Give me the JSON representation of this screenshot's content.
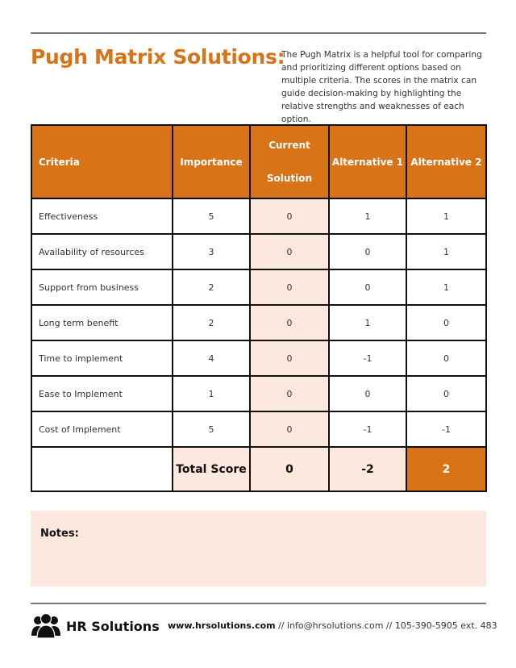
{
  "header": {
    "title": "Pugh Matrix Solutions:",
    "description": "The Pugh Matrix is a helpful tool for comparing and prioritizing different options based on multiple criteria. The scores in the matrix can guide decision-making by highlighting the relative strengths and weaknesses of each option."
  },
  "colors": {
    "accent": "#D97318",
    "highlight": "#FCE8DC",
    "border": "#111111"
  },
  "table": {
    "headers": {
      "criteria": "Criteria",
      "importance": "Importance",
      "current_line1": "Current",
      "current_line2": "Solution",
      "alt1": "Alternative 1",
      "alt2": "Alternative 2"
    },
    "rows": [
      {
        "criteria": "Effectiveness",
        "importance": "5",
        "current": "0",
        "alt1": "1",
        "alt2": "1"
      },
      {
        "criteria": "Availability of resources",
        "importance": "3",
        "current": "0",
        "alt1": "0",
        "alt2": "1"
      },
      {
        "criteria": "Support from business",
        "importance": "2",
        "current": "0",
        "alt1": "0",
        "alt2": "1"
      },
      {
        "criteria": "Long term benefit",
        "importance": "2",
        "current": "0",
        "alt1": "1",
        "alt2": "0"
      },
      {
        "criteria": "Time to implement",
        "importance": "4",
        "current": "0",
        "alt1": "-1",
        "alt2": "0"
      },
      {
        "criteria": "Ease to Implement",
        "importance": "1",
        "current": "0",
        "alt1": "0",
        "alt2": "0"
      },
      {
        "criteria": "Cost of Implement",
        "importance": "5",
        "current": "0",
        "alt1": "-1",
        "alt2": "-1"
      }
    ],
    "total": {
      "label": "Total Score",
      "current": "0",
      "alt1": "-2",
      "alt2": "2"
    }
  },
  "notes": {
    "label": "Notes:"
  },
  "footer": {
    "logo_icon": "people-group-icon",
    "brand": "HR Solutions",
    "website": "www.hrsolutions.com",
    "separator": " // ",
    "email": "info@hrsolutions.com",
    "phone": "105-390-5905 ext. 483"
  }
}
